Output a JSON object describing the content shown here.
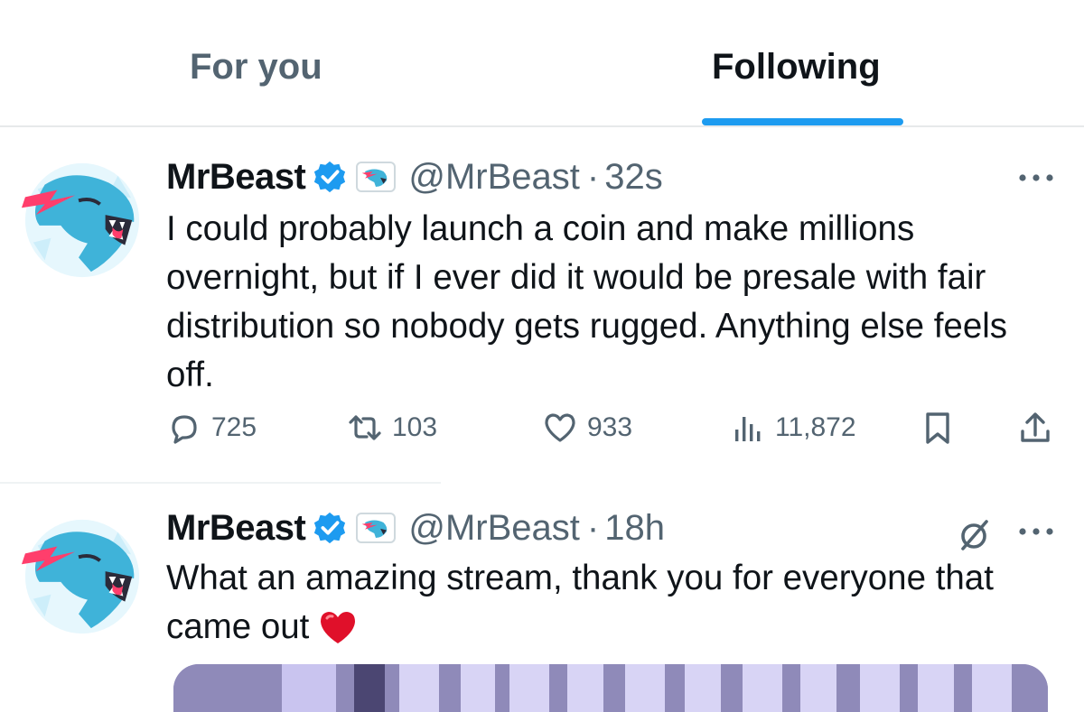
{
  "tabs": [
    {
      "label": "For you",
      "active": false
    },
    {
      "label": "Following",
      "active": true
    }
  ],
  "colors": {
    "accent": "#1d9bf0",
    "text_primary": "#0f1419",
    "text_secondary": "#536471",
    "brand_teal": "#3fb3d9",
    "brand_pink": "#ff3e6c",
    "heart_red": "#e0102a"
  },
  "tweets": [
    {
      "author_name": "MrBeast",
      "handle": "@MrBeast",
      "separator": "·",
      "time": "32s",
      "verified_icon": "verified-badge-icon",
      "affiliate_icon": "panther-logo-icon",
      "text": "I could probably launch a coin and make millions overnight, but if I ever did it would be presale with fair distribution so nobody gets rugged. Anything else feels off.",
      "metrics": {
        "replies": "725",
        "reposts": "103",
        "likes": "933",
        "views": "11,872"
      }
    },
    {
      "author_name": "MrBeast",
      "handle": "@MrBeast",
      "separator": "·",
      "time": "18h",
      "verified_icon": "verified-badge-icon",
      "affiliate_icon": "panther-logo-icon",
      "text": "What an amazing stream, thank you for everyone that came out",
      "emoji": "red-heart-emoji",
      "extra_icon": "slash-circle-icon"
    }
  ]
}
